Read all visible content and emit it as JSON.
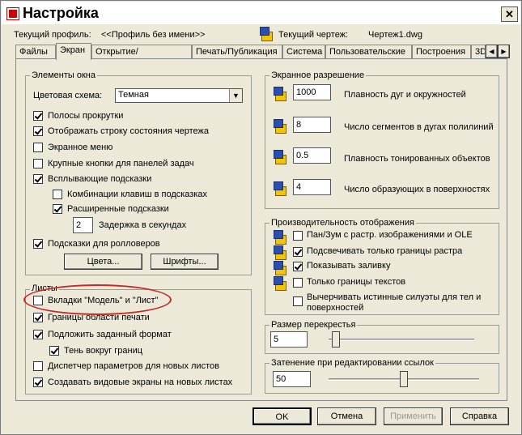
{
  "window": {
    "title": "Настройка",
    "close": "✕"
  },
  "profile": {
    "label": "Текущий профиль:",
    "value": "<<Профиль без имени>>"
  },
  "drawing": {
    "label": "Текущий чертеж:",
    "value": "Чертеж1.dwg"
  },
  "tabs": [
    "Файлы",
    "Экран",
    "Открытие/Сохранение",
    "Печать/Публикация",
    "Система",
    "Пользовательские",
    "Построения",
    "3D"
  ],
  "window_elements": {
    "title": "Элементы окна",
    "color_scheme_label": "Цветовая схема:",
    "color_scheme_value": "Темная",
    "options": [
      {
        "label": "Полосы прокрутки",
        "checked": true
      },
      {
        "label": "Отображать строку состояния чертежа",
        "checked": true
      },
      {
        "label": "Экранное меню",
        "checked": false
      },
      {
        "label": "Крупные кнопки для панелей задач",
        "checked": false
      },
      {
        "label": "Всплывающие подсказки",
        "checked": true
      },
      {
        "label": "Комбинации клавиш в подсказках",
        "checked": false
      },
      {
        "label": "Расширенные подсказки",
        "checked": true
      },
      {
        "label": "Подсказки для ролловеров",
        "checked": true
      }
    ],
    "delay_value": "2",
    "delay_label": "Задержка в секундах",
    "colors_button": "Цвета...",
    "fonts_button": "Шрифты..."
  },
  "sheets": {
    "title": "Листы",
    "options": [
      {
        "label": "Вкладки \"Модель\" и \"Лист\"",
        "checked": false
      },
      {
        "label": "Границы области печати",
        "checked": true
      },
      {
        "label": "Подложить заданный формат",
        "checked": true
      },
      {
        "label": "Тень вокруг границ",
        "checked": true
      },
      {
        "label": "Диспетчер параметров для новых листов",
        "checked": false
      },
      {
        "label": "Создавать видовые экраны на новых листах",
        "checked": true
      }
    ]
  },
  "resolution": {
    "title": "Экранное разрешение",
    "items": [
      {
        "value": "1000",
        "label": "Плавность дуг и окружностей"
      },
      {
        "value": "8",
        "label": "Число сегментов в дугах полилиний"
      },
      {
        "value": "0.5",
        "label": "Плавность тонированных объектов"
      },
      {
        "value": "4",
        "label": "Число образующих в поверхностях"
      }
    ]
  },
  "performance": {
    "title": "Производительность отображения",
    "options": [
      {
        "label": "Пан/Зум с растр. изображениями и OLE",
        "checked": false
      },
      {
        "label": "Подсвечивать только границы растра",
        "checked": true
      },
      {
        "label": "Показывать заливку",
        "checked": true
      },
      {
        "label": "Только границы текстов",
        "checked": false
      },
      {
        "label": "Вычерчивать истинные силуэты для тел и",
        "label2": "поверхностей",
        "checked": false
      }
    ]
  },
  "crosshair": {
    "title": "Размер перекрестья",
    "value": "5",
    "slider_fraction": 0.05
  },
  "xref_fade": {
    "title": "Затенение при редактировании ссылок",
    "value": "50",
    "slider_fraction": 0.5
  },
  "buttons": {
    "ok": "OK",
    "cancel": "Отмена",
    "apply": "Применить",
    "help": "Справка"
  }
}
